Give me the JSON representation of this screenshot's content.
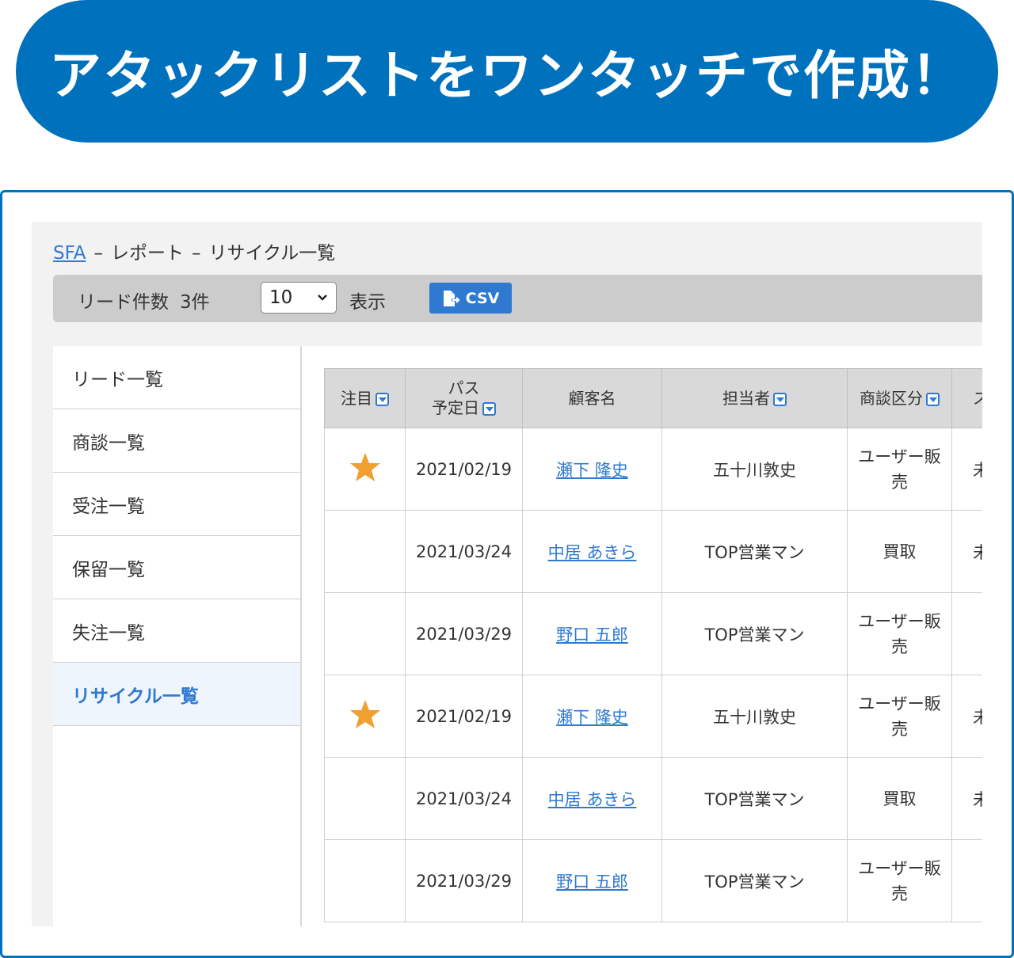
{
  "banner": {
    "title": "アタックリストをワンタッチで作成！"
  },
  "breadcrumb": {
    "root": "SFA",
    "sep1": "–",
    "report": "レポート",
    "sep2": "–",
    "current": "リサイクル一覧"
  },
  "toolbar": {
    "lead_count_label": "リード件数",
    "lead_count_value": "3件",
    "per_page_value": "10",
    "show_label": "表示",
    "csv_label": "CSV"
  },
  "sidebar": {
    "items": [
      {
        "label": "リード一覧",
        "active": false
      },
      {
        "label": "商談一覧",
        "active": false
      },
      {
        "label": "受注一覧",
        "active": false
      },
      {
        "label": "保留一覧",
        "active": false
      },
      {
        "label": "失注一覧",
        "active": false
      },
      {
        "label": "リサイクル一覧",
        "active": true
      }
    ]
  },
  "table": {
    "headers": {
      "attention": "注目",
      "pass_line1": "パス",
      "pass_line2": "予定日",
      "customer": "顧客名",
      "owner": "担当者",
      "deal_type": "商談区分",
      "extra": "ス"
    },
    "rows": [
      {
        "starred": true,
        "date": "2021/02/19",
        "customer": "瀬下 隆史",
        "owner": "五十川敦史",
        "deal_type_line1": "ユーザー販",
        "deal_type_line2": "売",
        "extra": "未"
      },
      {
        "starred": false,
        "date": "2021/03/24",
        "customer": "中居 あきら",
        "owner": "TOP営業マン",
        "deal_type_line1": "買取",
        "deal_type_line2": "",
        "extra": "未"
      },
      {
        "starred": false,
        "date": "2021/03/29",
        "customer": "野口 五郎",
        "owner": "TOP営業マン",
        "deal_type_line1": "ユーザー販",
        "deal_type_line2": "売",
        "extra": ""
      },
      {
        "starred": true,
        "date": "2021/02/19",
        "customer": "瀬下 隆史",
        "owner": "五十川敦史",
        "deal_type_line1": "ユーザー販",
        "deal_type_line2": "売",
        "extra": "未"
      },
      {
        "starred": false,
        "date": "2021/03/24",
        "customer": "中居 あきら",
        "owner": "TOP営業マン",
        "deal_type_line1": "買取",
        "deal_type_line2": "",
        "extra": "未"
      },
      {
        "starred": false,
        "date": "2021/03/29",
        "customer": "野口 五郎",
        "owner": "TOP営業マン",
        "deal_type_line1": "ユーザー販",
        "deal_type_line2": "売",
        "extra": ""
      }
    ]
  },
  "colors": {
    "brand": "#0071bc",
    "link": "#2f79d0",
    "star": "#f0a030"
  },
  "icons": {
    "sort": "dropdown-triangle-icon",
    "star": "star-icon",
    "csv": "file-export-icon",
    "select": "chevron-down-icon"
  }
}
